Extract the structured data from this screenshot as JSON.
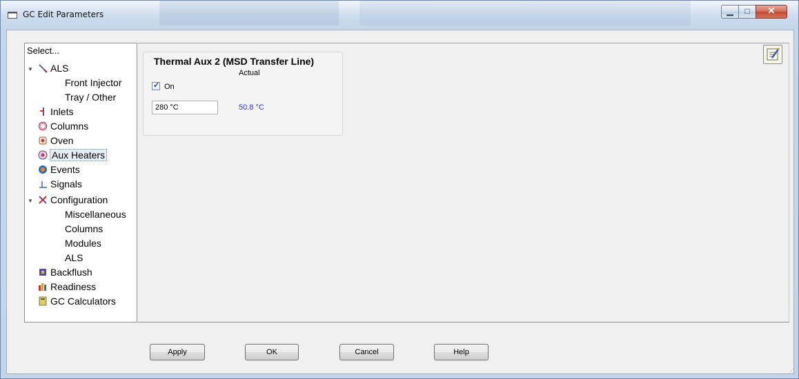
{
  "window": {
    "title": "GC Edit Parameters"
  },
  "tree": {
    "header": "Select...",
    "items": [
      {
        "label": "ALS",
        "icon": "syringe-icon"
      },
      {
        "label": "Front Injector",
        "icon": ""
      },
      {
        "label": "Tray / Other",
        "icon": ""
      },
      {
        "label": "Inlets",
        "icon": "inlet-icon"
      },
      {
        "label": "Columns",
        "icon": "column-coil-icon"
      },
      {
        "label": "Oven",
        "icon": "oven-icon"
      },
      {
        "label": "Aux Heaters",
        "icon": "heater-icon"
      },
      {
        "label": "Events",
        "icon": "events-icon"
      },
      {
        "label": "Signals",
        "icon": "signal-icon"
      },
      {
        "label": "Configuration",
        "icon": "wrench-icon"
      },
      {
        "label": "Miscellaneous",
        "icon": ""
      },
      {
        "label": "Columns",
        "icon": ""
      },
      {
        "label": "Modules",
        "icon": ""
      },
      {
        "label": "ALS",
        "icon": ""
      },
      {
        "label": "Backflush",
        "icon": "backflush-icon"
      },
      {
        "label": "Readiness",
        "icon": "readiness-icon"
      },
      {
        "label": "GC Calculators",
        "icon": "calculator-icon"
      }
    ],
    "selected": "Aux Heaters"
  },
  "aux": {
    "title": "Thermal Aux 2 (MSD Transfer Line)",
    "actual_header": "Actual",
    "on_label": "On",
    "on_checked": true,
    "setpoint": "280 °C",
    "actual_value": "50.8 °C"
  },
  "buttons": {
    "apply": "Apply",
    "ok": "OK",
    "cancel": "Cancel",
    "help": "Help"
  },
  "colors": {
    "actual_value": "#2b35d8",
    "selection": "#e5eef9"
  }
}
